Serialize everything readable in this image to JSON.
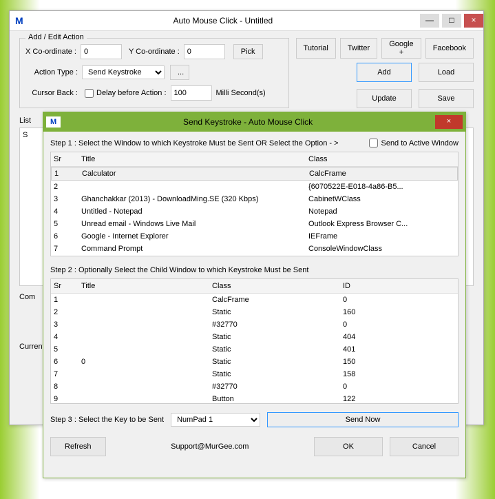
{
  "w1": {
    "title": "Auto Mouse Click - Untitled",
    "legend": "Add / Edit Action",
    "links": {
      "tutorial": "Tutorial",
      "twitter": "Twitter",
      "google": "Google +",
      "facebook": "Facebook"
    },
    "xco": "X Co-ordinate :",
    "xval": "0",
    "yco": "Y Co-ordinate :",
    "yval": "0",
    "pick": "Pick",
    "actiontype": "Action Type :",
    "actionval": "Send Keystroke",
    "dots": "...",
    "cursor": "Cursor Back :",
    "delay": "Delay before Action :",
    "delayval": "100",
    "ms": "Milli Second(s)",
    "add": "Add",
    "load": "Load",
    "update": "Update",
    "save": "Save",
    "list": "List",
    "s_lbl": "S",
    "comment": "Com",
    "current": "Current"
  },
  "w2": {
    "title": "Send Keystroke - Auto Mouse Click",
    "step1": "Step 1 : Select the Window to which Keystroke Must be Sent OR Select the Option - >",
    "sendactive": "Send to Active Window",
    "t1": {
      "h": [
        "Sr",
        "Title",
        "Class"
      ],
      "rows": [
        [
          "1",
          "Calculator",
          "CalcFrame"
        ],
        [
          "2",
          "",
          "{6070522E-E018-4a86-B5..."
        ],
        [
          "3",
          "Ghanchakkar (2013) - DownloadMing.SE (320 Kbps)",
          "CabinetWClass"
        ],
        [
          "4",
          "Untitled - Notepad",
          "Notepad"
        ],
        [
          "5",
          "Unread email - Windows Live Mail",
          "Outlook Express Browser C..."
        ],
        [
          "6",
          "Google - Internet Explorer",
          "IEFrame"
        ],
        [
          "7",
          "Command Prompt",
          "ConsoleWindowClass"
        ]
      ]
    },
    "step2": "Step 2 : Optionally Select the Child Window to which Keystroke Must be Sent",
    "t2": {
      "h": [
        "Sr",
        "Title",
        "Class",
        "ID"
      ],
      "rows": [
        [
          "1",
          "",
          "CalcFrame",
          "0"
        ],
        [
          "2",
          "",
          "Static",
          "160"
        ],
        [
          "3",
          "",
          "#32770",
          "0"
        ],
        [
          "4",
          "",
          "Static",
          "404"
        ],
        [
          "5",
          "",
          "Static",
          "401"
        ],
        [
          "6",
          "0",
          "Static",
          "150"
        ],
        [
          "7",
          "",
          "Static",
          "158"
        ],
        [
          "8",
          "",
          "#32770",
          "0"
        ],
        [
          "9",
          "",
          "Button",
          "122"
        ]
      ]
    },
    "step3": "Step 3 :  Select the Key to be Sent",
    "key": "NumPad 1",
    "sendnow": "Send Now",
    "refresh": "Refresh",
    "support": "Support@MurGee.com",
    "ok": "OK",
    "cancel": "Cancel"
  }
}
